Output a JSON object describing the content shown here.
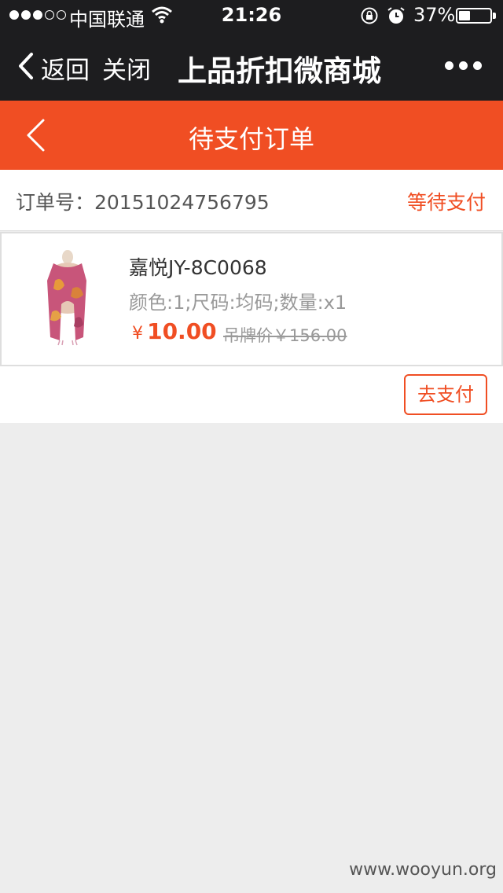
{
  "status_bar": {
    "carrier": "中国联通",
    "time": "21:26",
    "battery_percent": "37%",
    "battery_level": 0.37,
    "signal_bars_filled": 3,
    "signal_bars_total": 5
  },
  "wechat_nav": {
    "back_label": "返回",
    "close_label": "关闭",
    "title": "上品折扣微商城"
  },
  "page_header": {
    "title": "待支付订单"
  },
  "order": {
    "number_text": "订单号：20151024756795",
    "status": "等待支付"
  },
  "product": {
    "name": "嘉悦JY-8C0068",
    "spec": "颜色:1;尺码:均码;数量:x1",
    "currency": "¥",
    "price": "10.00",
    "original_price": "吊牌价￥156.00"
  },
  "actions": {
    "pay_label": "去支付"
  },
  "watermark": "www.wooyun.org",
  "colors": {
    "accent": "#f04e23",
    "dark_bar": "#1d1d1f",
    "background": "#ededed"
  }
}
